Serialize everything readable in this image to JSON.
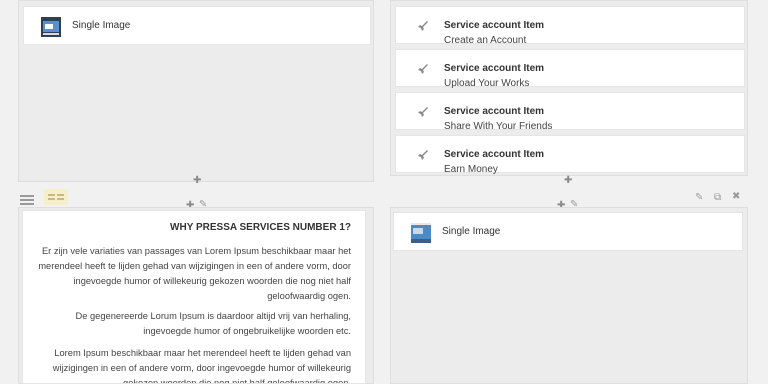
{
  "top_left": {
    "element": {
      "title": "Single Image",
      "icon": "single-image-icon"
    }
  },
  "top_right": {
    "items": [
      {
        "title": "Service account Item",
        "subtitle": "Create an Account"
      },
      {
        "title": "Service account Item",
        "subtitle": "Upload Your Works"
      },
      {
        "title": "Service account Item",
        "subtitle": "Share With Your Friends"
      },
      {
        "title": "Service account Item",
        "subtitle": "Earn Money"
      }
    ]
  },
  "bottom_left": {
    "heading": "WHY PRESSA SERVICES NUMBER 1?",
    "paragraphs": [
      "Er zijn vele variaties van passages van Lorem Ipsum beschikbaar maar het merendeel heeft te lijden gehad van wijzigingen in een of andere vorm, door ingevoegde humor of willekeurig gekozen woorden die nog niet half geloofwaardig ogen.",
      "De gegenereerde Lorum Ipsum is daardoor altijd vrij van herhaling, ingevoegde humor of ongebruikelijke woorden etc.",
      "Lorem Ipsum beschikbaar maar het merendeel heeft te lijden gehad van wijzigingen in een of andere vorm, door ingevoegde humor of willekeurig gekozen woorden die nog niet half geloofwaardig ogen."
    ]
  },
  "bottom_right": {
    "element": {
      "title": "Single Image",
      "icon": "single-image-thumb-icon"
    }
  },
  "colors": {
    "accent_row_selected": "#f6f0c8",
    "icon_gray": "#9a9a9a"
  }
}
